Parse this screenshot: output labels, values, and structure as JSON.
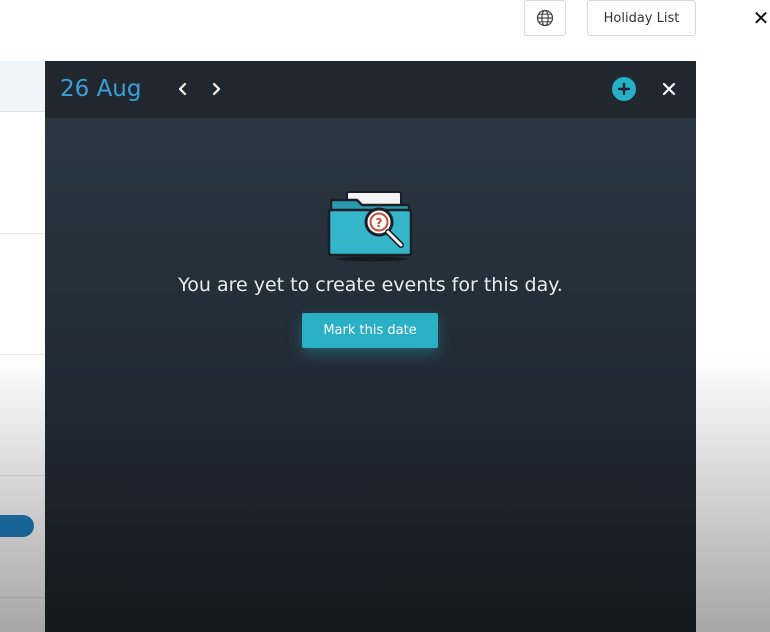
{
  "topbar": {
    "globe_icon": "globe-icon",
    "holiday_label": "Holiday List",
    "close_symbol": "✕"
  },
  "panel": {
    "date": "26 Aug",
    "prev_icon": "chevron-left-icon",
    "next_icon": "chevron-right-icon",
    "add_icon": "plus-circle-icon",
    "close_icon": "close-icon",
    "empty_icon": "folder-search-icon",
    "empty_message": "You are yet to create events for this day.",
    "mark_button": "Mark this date"
  },
  "colors": {
    "accent": "#29b0c4",
    "date_blue": "#3aa0d8",
    "panel_header": "#20272f"
  }
}
